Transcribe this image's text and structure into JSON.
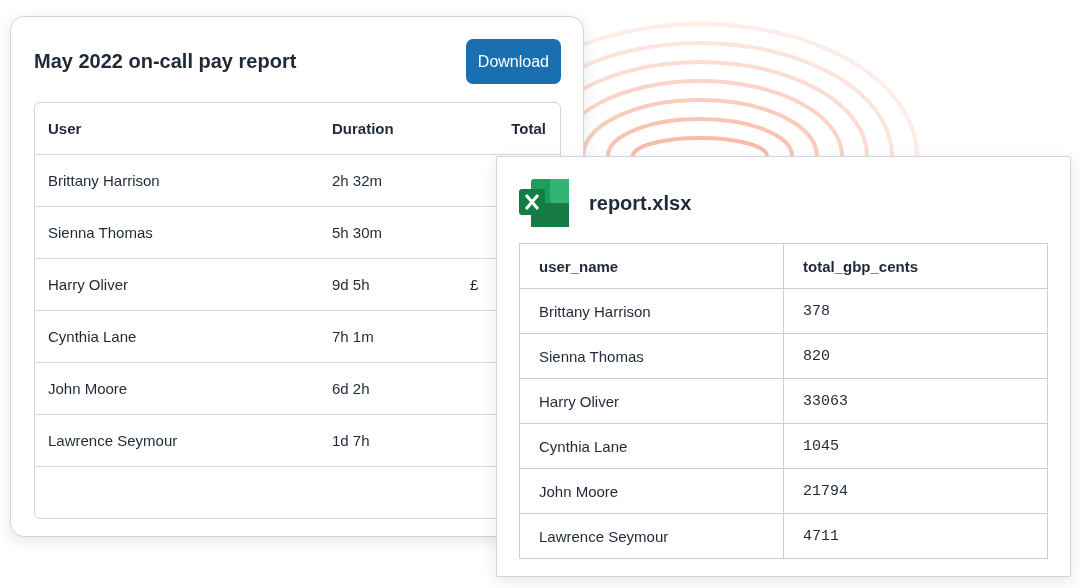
{
  "report": {
    "title": "May 2022 on-call pay report",
    "download_button": "Download",
    "columns": [
      "User",
      "Duration",
      "Total"
    ],
    "rows": [
      {
        "user": "Brittany Harrison",
        "duration": "2h 32m"
      },
      {
        "user": "Sienna Thomas",
        "duration": "5h 30m"
      },
      {
        "user": "Harry Oliver",
        "duration": "9d 5h",
        "total": "£"
      },
      {
        "user": "Cynthia Lane",
        "duration": "7h 1m"
      },
      {
        "user": "John Moore",
        "duration": "6d 2h"
      },
      {
        "user": "Lawrence Seymour",
        "duration": "1d 7h"
      },
      {
        "user": "",
        "duration": ""
      }
    ]
  },
  "file": {
    "title": "report.xlsx",
    "columns": [
      "user_name",
      "total_gbp_cents"
    ],
    "rows": [
      {
        "user_name": "Brittany Harrison",
        "total_gbp_cents": "378"
      },
      {
        "user_name": "Sienna Thomas",
        "total_gbp_cents": "820"
      },
      {
        "user_name": "Harry Oliver",
        "total_gbp_cents": "33063"
      },
      {
        "user_name": "Cynthia Lane",
        "total_gbp_cents": "1045"
      },
      {
        "user_name": "John Moore",
        "total_gbp_cents": "21794"
      },
      {
        "user_name": "Lawrence Seymour",
        "total_gbp_cents": "4711"
      }
    ]
  }
}
